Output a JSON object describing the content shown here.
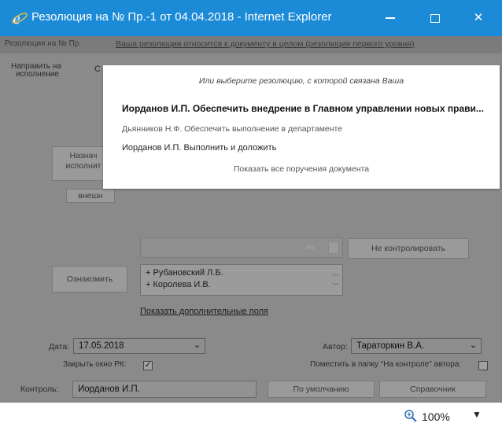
{
  "window": {
    "title": "Резолюция на № Пр.-1 от 04.04.2018 - Internet Explorer",
    "icon": "ie-logo-icon",
    "accent": "#1b8ad7"
  },
  "tabs": {
    "left_tab": "Резолюция на № Пр.",
    "link": "Ваша резолюция относится к документу в целом (резолюция первого уровня)"
  },
  "toolbar": {
    "send_line1": "Направить на",
    "send_line2": "исполнение",
    "c_label": "С"
  },
  "form": {
    "assign_line1": "Назнач",
    "assign_line2": "исполнит",
    "external": "внешн",
    "no_control": "Не контролировать",
    "familiarize": "Ознакомить",
    "recipients": [
      "+ Рубановский Л.Б.",
      "+ Королева И.В."
    ],
    "show_more": "Показать дополнительные поля",
    "date_label": "Дата:",
    "date_value": "17.05.2018",
    "author_label": "Автор:",
    "author_value": "Тараторкин В.А.",
    "close_rk_label": "Закрыть окно РК:",
    "close_rk_checked": true,
    "folder_label": "Поместить в папку \"На контроле\" автора:",
    "folder_checked": false,
    "control_label": "Контроль:",
    "control_value": "Иорданов И.П.",
    "default_button": "По умолчанию",
    "reference_button": "Справочник"
  },
  "popup": {
    "hint": "Или выберите резолюцию, с которой связана Ваша",
    "options": [
      "Иорданов И.П. Обеспечить внедрение в Главном управлении новых прави...",
      "Дьянников Н.Ф. Обеспечить выполнение в департаменте",
      "Иорданов И.П. Выполнить и доложить"
    ],
    "show_all": "Показать все поручения документа"
  },
  "status": {
    "zoom": "100%"
  }
}
